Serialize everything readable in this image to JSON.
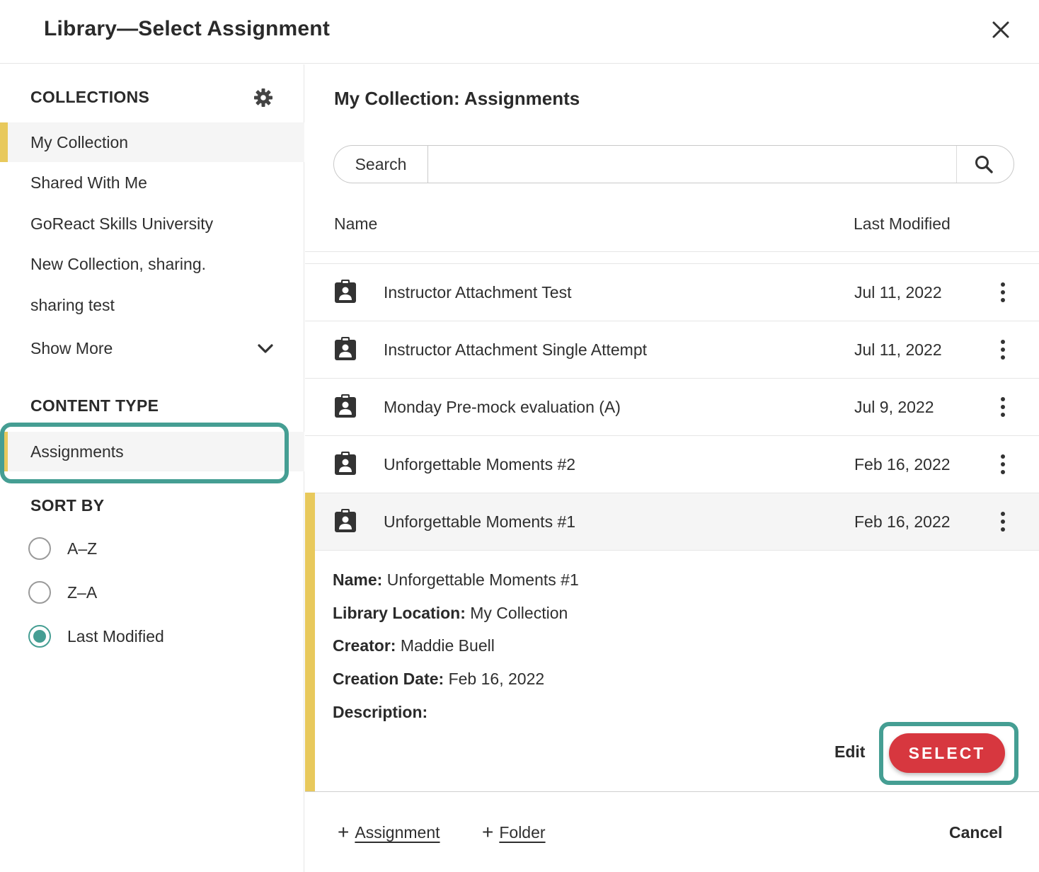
{
  "dialog": {
    "title": "Library—Select Assignment"
  },
  "sidebar": {
    "collections_heading": "COLLECTIONS",
    "collections": [
      {
        "label": "My Collection",
        "active": true
      },
      {
        "label": "Shared With Me"
      },
      {
        "label": "GoReact Skills University"
      },
      {
        "label": "New Collection, sharing."
      },
      {
        "label": "sharing test"
      }
    ],
    "show_more": "Show More",
    "content_type_heading": "CONTENT TYPE",
    "content_type_item": "Assignments",
    "sort_heading": "SORT BY",
    "sort_options": [
      {
        "label": "A–Z",
        "checked": false
      },
      {
        "label": "Z–A",
        "checked": false
      },
      {
        "label": "Last Modified",
        "checked": true
      }
    ]
  },
  "main": {
    "title": "My Collection: Assignments",
    "search": {
      "label": "Search",
      "value": "",
      "placeholder": ""
    },
    "columns": {
      "name": "Name",
      "modified": "Last Modified"
    },
    "rows": [
      {
        "name": "Instructor Attachment Test",
        "date": "Jul 11, 2022"
      },
      {
        "name": "Instructor Attachment Single Attempt",
        "date": "Jul 11, 2022"
      },
      {
        "name": "Monday Pre-mock evaluation (A)",
        "date": "Jul 9, 2022"
      },
      {
        "name": "Unforgettable Moments #2",
        "date": "Feb 16, 2022"
      },
      {
        "name": "Unforgettable Moments #1",
        "date": "Feb 16, 2022",
        "selected": true
      }
    ],
    "details": {
      "name_label": "Name:",
      "name_value": "Unforgettable Moments #1",
      "location_label": "Library Location:",
      "location_value": "My Collection",
      "creator_label": "Creator:",
      "creator_value": "Maddie Buell",
      "date_label": "Creation Date:",
      "date_value": "Feb 16, 2022",
      "description_label": "Description:"
    },
    "edit_label": "Edit",
    "select_label": "SELECT",
    "footer": {
      "add_assignment": "Assignment",
      "add_folder": "Folder",
      "cancel": "Cancel"
    }
  },
  "colors": {
    "accent_teal": "#459e93",
    "select_red": "#d7373f",
    "active_yellow": "#e8c95c"
  },
  "icons": {
    "close": "close-icon",
    "settings": "gear-icon",
    "search": "search-icon",
    "row": "clipboard-user-icon",
    "row_menu": "kebab-menu-icon",
    "expand": "chevron-down-icon",
    "add": "plus-icon"
  }
}
